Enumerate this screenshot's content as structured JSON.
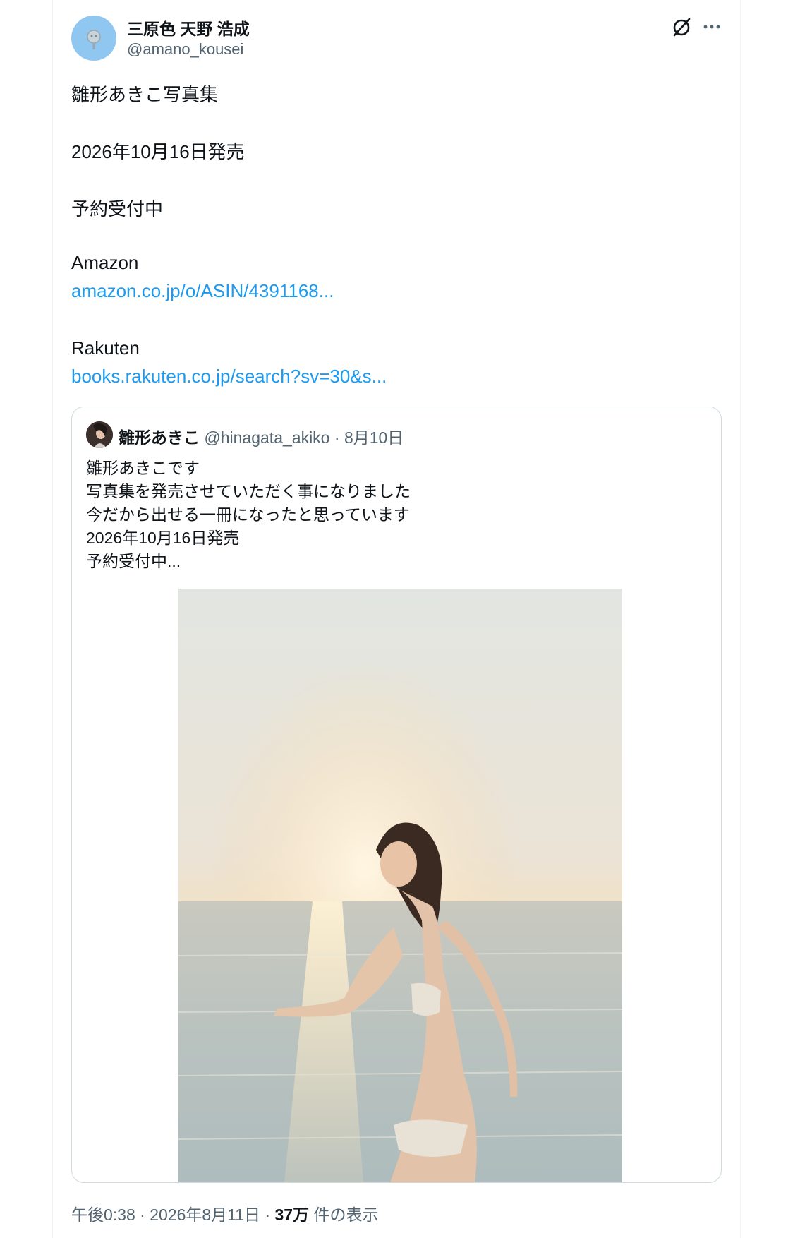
{
  "author": {
    "display_name": "三原色 天野 浩成",
    "handle": "@amano_kousei"
  },
  "tweet": {
    "lines": [
      "雛形あきこ写真集",
      "2026年10月16日発売",
      "予約受付中",
      "Amazon",
      "amazon.co.jp/o/ASIN/4391168...",
      "Rakuten",
      "books.rakuten.co.jp/search?sv=30&s..."
    ]
  },
  "quote": {
    "display_name": "雛形あきこ",
    "handle": "@hinagata_akiko",
    "separator": "·",
    "date": "8月10日",
    "lines": [
      "雛形あきこです",
      "写真集を発売させていただく事になりました",
      "今だから出せる一冊になったと思っています",
      "2026年10月16日発売",
      "予約受付中..."
    ]
  },
  "footer": {
    "time": "午後0:38",
    "separator": "·",
    "date": "2026年8月11日",
    "views_count": "37万",
    "views_label": "件の表示"
  },
  "icons": {
    "grok": "grok-icon",
    "more": "more-icon"
  },
  "colors": {
    "link": "#1d9bf0",
    "secondary_text": "#536471",
    "primary_text": "#0f1419",
    "avatar_bg": "#8fc7f1"
  }
}
